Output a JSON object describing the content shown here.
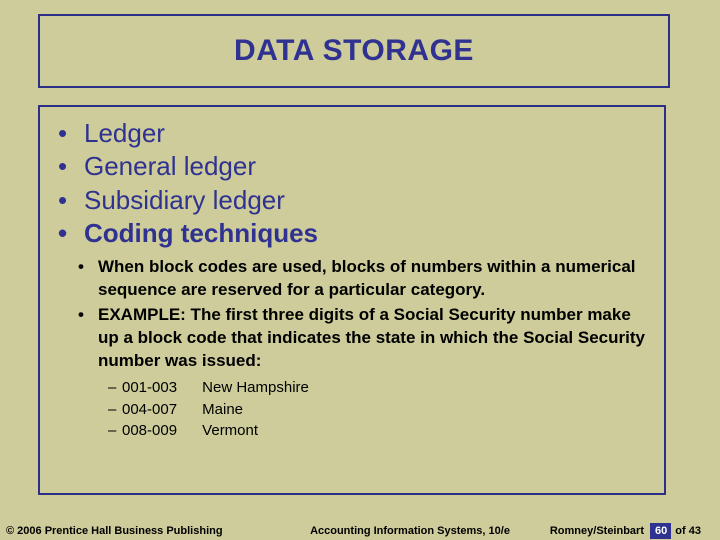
{
  "title": "DATA STORAGE",
  "bullets": {
    "b1": "Ledger",
    "b2": "General ledger",
    "b3": "Subsidiary ledger",
    "b4": "Coding techniques"
  },
  "sub": {
    "s1": "When block codes are used, blocks of numbers within a numerical sequence are reserved for a particular category.",
    "s2": "EXAMPLE:  The first three digits of a Social Security number make up a block code that indicates the state in which the Social Security number was issued:"
  },
  "codes": {
    "c1": {
      "range": "001-003",
      "state": "New Hampshire"
    },
    "c2": {
      "range": "004-007",
      "state": "Maine"
    },
    "c3": {
      "range": "008-009",
      "state": "Vermont"
    }
  },
  "footer": {
    "copyright": "© 2006 Prentice Hall Business Publishing",
    "book": "Accounting Information Systems, 10/e",
    "authors": "Romney/Steinbart",
    "page_current": "60",
    "page_of": "of",
    "page_total": "43"
  }
}
